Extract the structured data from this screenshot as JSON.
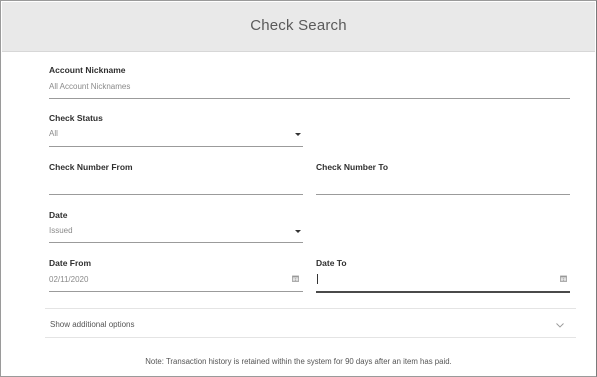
{
  "header": {
    "title": "Check Search"
  },
  "form": {
    "account_nickname": {
      "label": "Account Nickname",
      "placeholder": "All Account Nicknames"
    },
    "check_status": {
      "label": "Check Status",
      "value": "All"
    },
    "check_number_from": {
      "label": "Check Number From",
      "value": ""
    },
    "check_number_to": {
      "label": "Check Number To",
      "value": ""
    },
    "date": {
      "label": "Date",
      "value": "Issued"
    },
    "date_from": {
      "label": "Date From",
      "value": "02/11/2020"
    },
    "date_to": {
      "label": "Date To",
      "value": ""
    }
  },
  "options": {
    "label": "Show additional options"
  },
  "note": "Note: Transaction history is retained within the system for 90 days after an item has paid."
}
